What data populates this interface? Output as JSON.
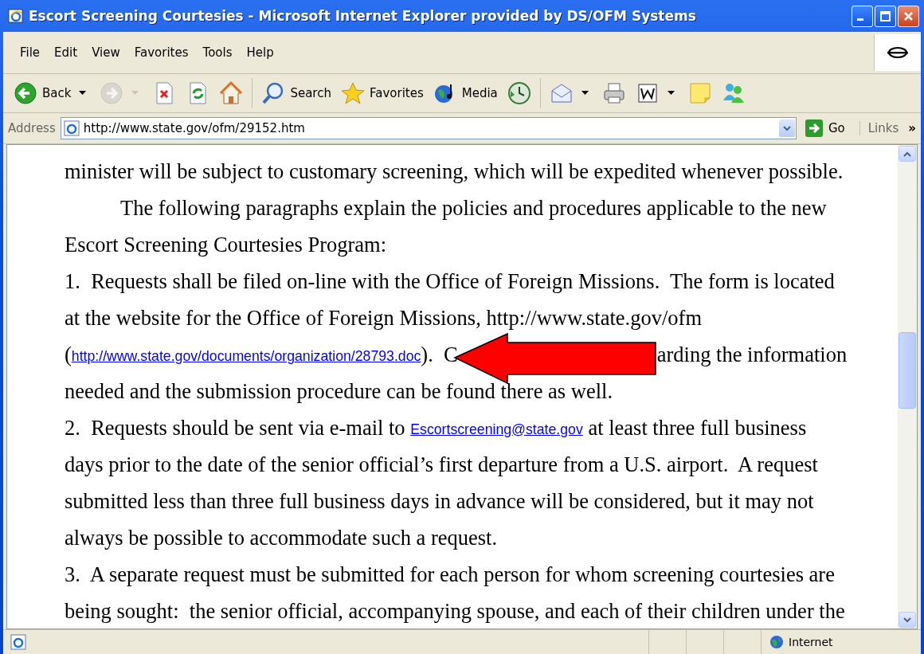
{
  "window": {
    "title": "Escort Screening Courtesies - Microsoft Internet Explorer provided by DS/OFM Systems"
  },
  "menu": [
    "File",
    "Edit",
    "View",
    "Favorites",
    "Tools",
    "Help"
  ],
  "toolbar": [
    {
      "label": "Back",
      "disabled": false,
      "dropdown": true
    },
    {
      "disabled": true,
      "dropdown": true
    },
    {
      "disabled": false,
      "dropdown": false
    },
    {
      "disabled": false,
      "dropdown": false
    },
    {
      "disabled": false,
      "dropdown": false
    },
    {
      "label": "Search",
      "disabled": false,
      "dropdown": false
    },
    {
      "label": "Favorites",
      "disabled": false,
      "dropdown": false
    },
    {
      "label": "Media",
      "disabled": false,
      "dropdown": false
    },
    {
      "disabled": false,
      "dropdown": false
    },
    {
      "disabled": false,
      "dropdown": true
    },
    {
      "disabled": false,
      "dropdown": false
    },
    {
      "disabled": false,
      "dropdown": true
    },
    {
      "disabled": false,
      "dropdown": false
    },
    {
      "disabled": false,
      "dropdown": false
    }
  ],
  "address": {
    "label": "Address",
    "value": "http://www.state.gov/ofm/29152.htm",
    "go": "Go",
    "links": "Links",
    "more": "»"
  },
  "content": {
    "lines": [
      {
        "indent": false,
        "segments": [
          {
            "kind": "text",
            "text": "minister will be subject to customary screening, which will be expedited whenever possible."
          }
        ]
      },
      {
        "indent": true,
        "segments": [
          {
            "kind": "text",
            "text": "The following paragraphs explain the policies and procedures applicable to the new"
          }
        ]
      },
      {
        "indent": false,
        "segments": [
          {
            "kind": "text",
            "text": "Escort Screening Courtesies Program:"
          }
        ]
      },
      {
        "indent": false,
        "segments": [
          {
            "kind": "text",
            "text": "1.  Requests shall be filed on-line with the Office of Foreign Missions.  The form is located"
          }
        ]
      },
      {
        "indent": false,
        "segments": [
          {
            "kind": "text",
            "text": "at the website for the Office of Foreign Missions, http://www.state.gov/ofm"
          }
        ]
      },
      {
        "indent": false,
        "segments": [
          {
            "kind": "text",
            "text": "("
          },
          {
            "kind": "link",
            "text": "http://www.state.gov/documents/organization/28793.doc"
          },
          {
            "kind": "text",
            "text": ").  C"
          },
          {
            "kind": "arrow"
          },
          {
            "kind": "text",
            "text": "arding the information"
          }
        ]
      },
      {
        "indent": false,
        "segments": [
          {
            "kind": "text",
            "text": "needed and the submission procedure can be found there as well."
          }
        ]
      },
      {
        "indent": false,
        "segments": [
          {
            "kind": "text",
            "text": "2.  Requests should be sent via e-mail to "
          },
          {
            "kind": "link",
            "text": "Escortscreening@state.gov"
          },
          {
            "kind": "text",
            "text": " at least three full business"
          }
        ]
      },
      {
        "indent": false,
        "segments": [
          {
            "kind": "text",
            "text": "days prior to the date of the senior official’s first departure from a U.S. airport.  A request"
          }
        ]
      },
      {
        "indent": false,
        "segments": [
          {
            "kind": "text",
            "text": "submitted less than three full business days in advance will be considered, but it may not"
          }
        ]
      },
      {
        "indent": false,
        "segments": [
          {
            "kind": "text",
            "text": "always be possible to accommodate such a request."
          }
        ]
      },
      {
        "indent": false,
        "segments": [
          {
            "kind": "text",
            "text": "3.  A separate request must be submitted for each person for whom screening courtesies are"
          }
        ]
      },
      {
        "indent": false,
        "segments": [
          {
            "kind": "text",
            "text": "being sought:  the senior official, accompanying spouse, and each of their children under the"
          }
        ]
      }
    ]
  },
  "status": {
    "zone": "Internet"
  }
}
